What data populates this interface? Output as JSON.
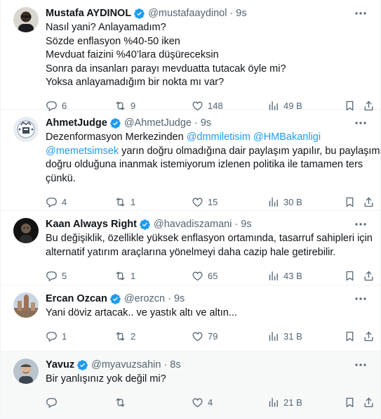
{
  "tweets": [
    {
      "name": "Mustafa AYDINOL",
      "handle": "@mustafaaydinol",
      "time": "9s",
      "lines": [
        "Nasıl yani? Anlayamadım?",
        "Sözde enflasyon %40-50 iken",
        "Mevduat faizini %40’lara düşüreceksin",
        "Sonra da insanları parayı mevduatta tutacak öyle mi?",
        "Yoksa anlayamadığım bir nokta mı var?"
      ],
      "replies": "6",
      "retweets": "9",
      "likes": "148",
      "views": "49 B"
    },
    {
      "name": "AhmetJudge",
      "handle": "@AhmetJudge",
      "time": "9s",
      "line1_prefix": "Dezenformasyon Merkezinden ",
      "mention1": "@dmmiletisim",
      "mention2": "@HMBakanligi",
      "mention3": "@memetsimsek",
      "line2_rest": " yarın doğru olmadığına dair paylaşım yapılır, bu paylaşımın",
      "line3": "doğru olduğuna inanmak istemiyorum izlenen politika ile tamamen ters",
      "line4": "çünkü.",
      "replies": "4",
      "retweets": "1",
      "likes": "15",
      "views": "30 B"
    },
    {
      "name": "Kaan Always Right",
      "handle": "@havadiszamani",
      "time": "9s",
      "lines": [
        "Bu değişiklik, özellikle yüksek enflasyon ortamında, tasarruf sahipleri için",
        "alternatif yatırım araçlarına yönelmeyi daha cazip hale getirebilir."
      ],
      "replies": "5",
      "retweets": "1",
      "likes": "65",
      "views": "43 B"
    },
    {
      "name": "Ercan Ozcan",
      "handle": "@erozcn",
      "time": "9s",
      "lines": [
        "Yani döviz artacak.. ve yastık altı ve altın..."
      ],
      "replies": "1",
      "retweets": "2",
      "likes": "79",
      "views": "31 B"
    },
    {
      "name": "Yavuz",
      "handle": "@myavuzsahin",
      "time": "8s",
      "lines": [
        "Bir yanlışınız yok değil mi?"
      ],
      "replies": "",
      "retweets": "",
      "likes": "4",
      "views": "21 B"
    }
  ],
  "colors": {
    "accent": "#1d9bf0",
    "muted": "#536471",
    "text": "#0f1419",
    "border": "#eff3f4"
  },
  "icons": [
    "verified-badge-icon",
    "more-icon",
    "reply-icon",
    "retweet-icon",
    "like-icon",
    "views-icon",
    "bookmark-icon",
    "share-icon"
  ]
}
